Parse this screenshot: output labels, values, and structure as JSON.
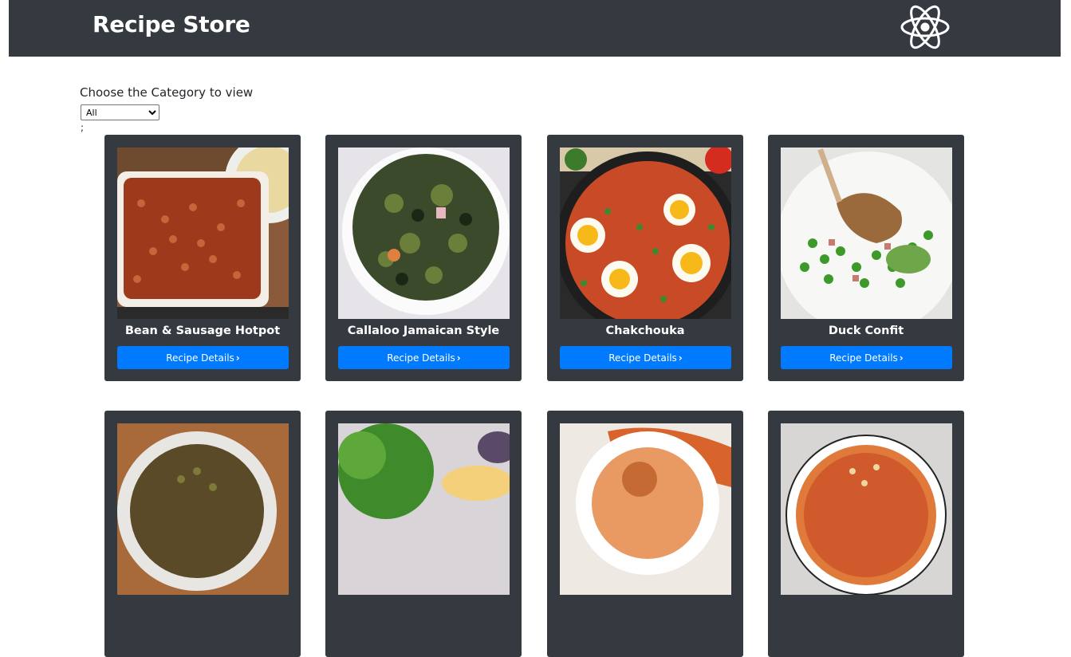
{
  "navbar": {
    "brand": "Recipe Store",
    "logo_icon": "react-atom-icon"
  },
  "filter": {
    "label": "Choose the Category to view",
    "selected": "All",
    "stray_text": ";"
  },
  "recipes": [
    {
      "title": "Bean & Sausage Hotpot",
      "button_label": "Recipe Details",
      "button_icon": "chevron-right-icon"
    },
    {
      "title": "Callaloo Jamaican Style",
      "button_label": "Recipe Details",
      "button_icon": "chevron-right-icon"
    },
    {
      "title": "Chakchouka",
      "button_label": "Recipe Details",
      "button_icon": "chevron-right-icon"
    },
    {
      "title": "Duck Confit",
      "button_label": "Recipe Details",
      "button_icon": "chevron-right-icon"
    },
    {
      "title": "",
      "button_label": "",
      "button_icon": ""
    },
    {
      "title": "",
      "button_label": "",
      "button_icon": ""
    },
    {
      "title": "",
      "button_label": "",
      "button_icon": ""
    },
    {
      "title": "",
      "button_label": "",
      "button_icon": ""
    }
  ],
  "colors": {
    "navbar": "#343a40",
    "card": "#343a40",
    "button": "#007bff"
  }
}
